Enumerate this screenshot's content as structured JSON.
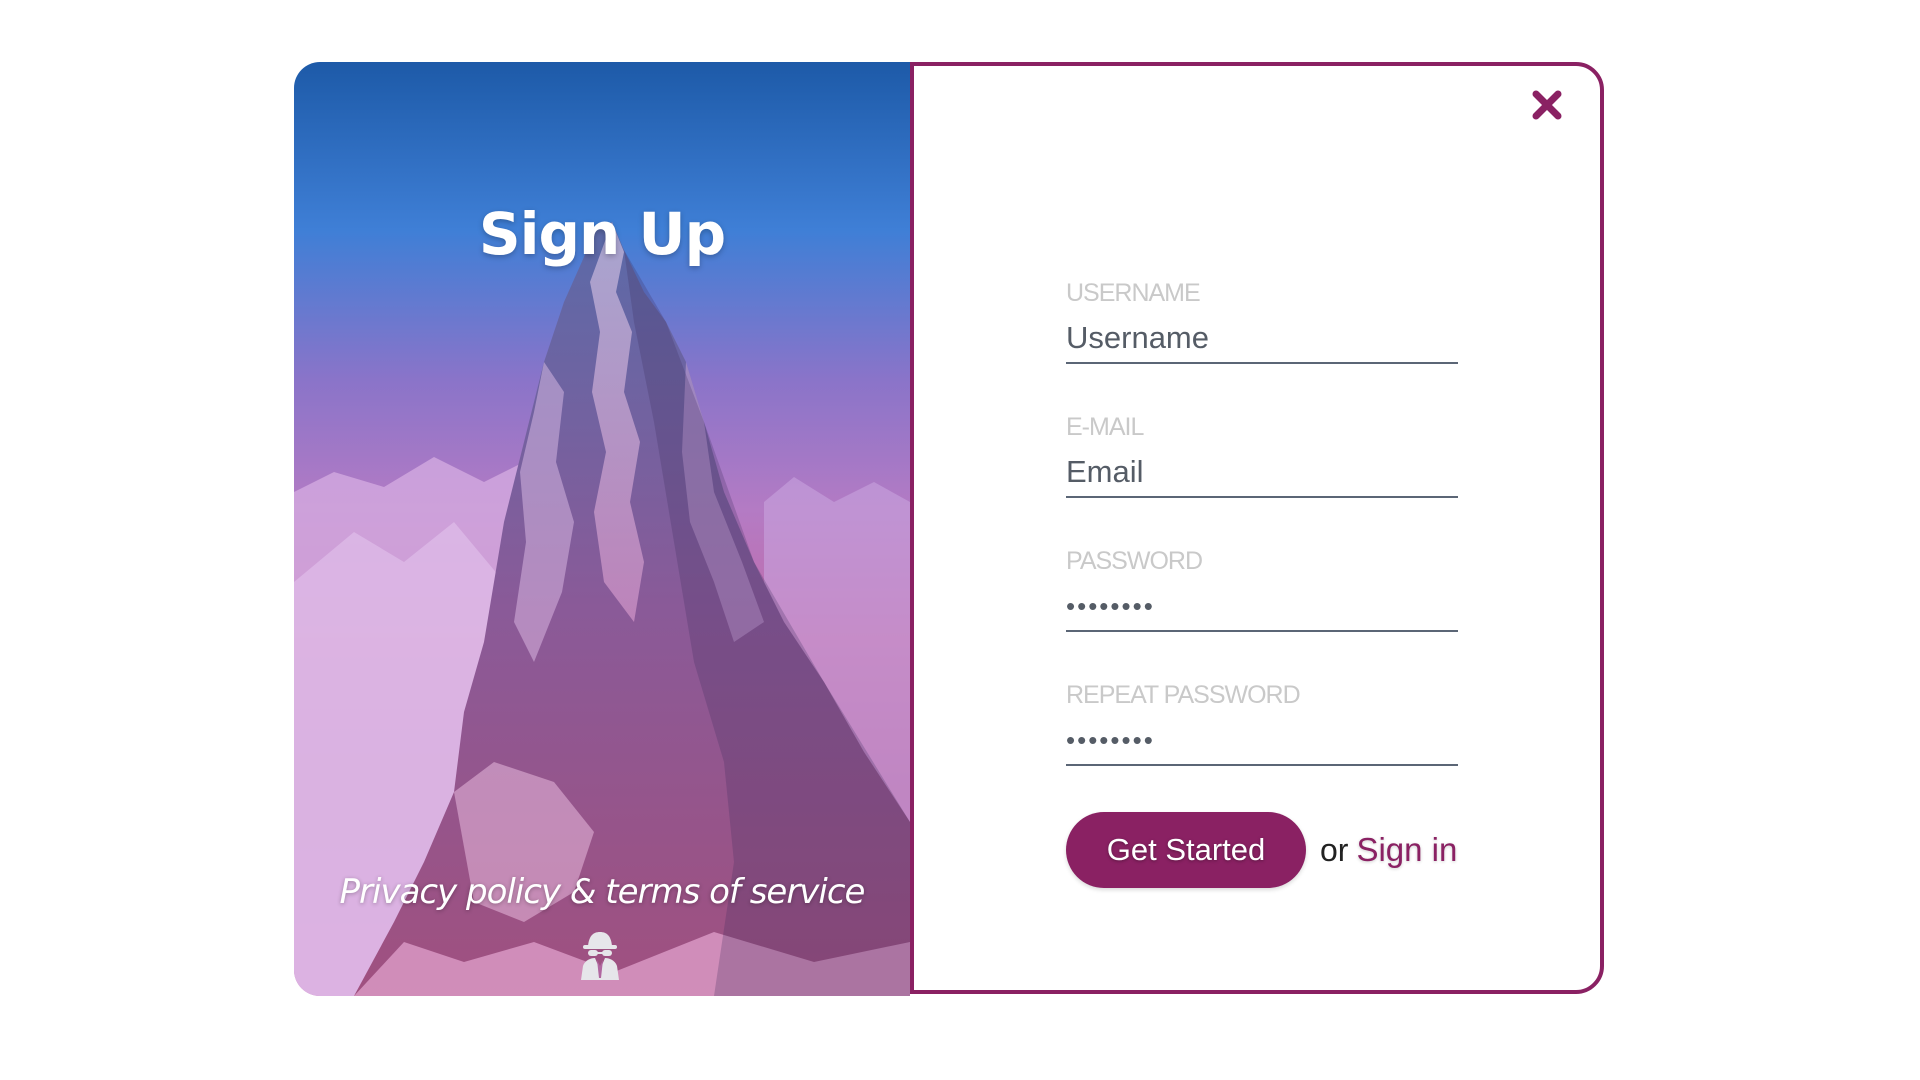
{
  "header": {
    "title": "Sign Up"
  },
  "footer": {
    "privacy_text": "Privacy policy & terms of service",
    "privacy_icon": "spy-icon"
  },
  "form": {
    "fields": [
      {
        "label": "USERNAME",
        "placeholder": "Username",
        "value": "",
        "type": "text"
      },
      {
        "label": "E-MAIL",
        "placeholder": "Email",
        "value": "",
        "type": "email"
      },
      {
        "label": "PASSWORD",
        "placeholder": "",
        "value": "••••••••",
        "type": "password"
      },
      {
        "label": "REPEAT PASSWORD",
        "placeholder": "",
        "value": "••••••••",
        "type": "password"
      }
    ],
    "submit_label": "Get Started",
    "or_text": "or",
    "signin_label": "Sign in"
  },
  "close_icon": "close-icon",
  "colors": {
    "accent": "#8a2163",
    "label": "#c9c9c9",
    "underline": "#5b6676"
  }
}
